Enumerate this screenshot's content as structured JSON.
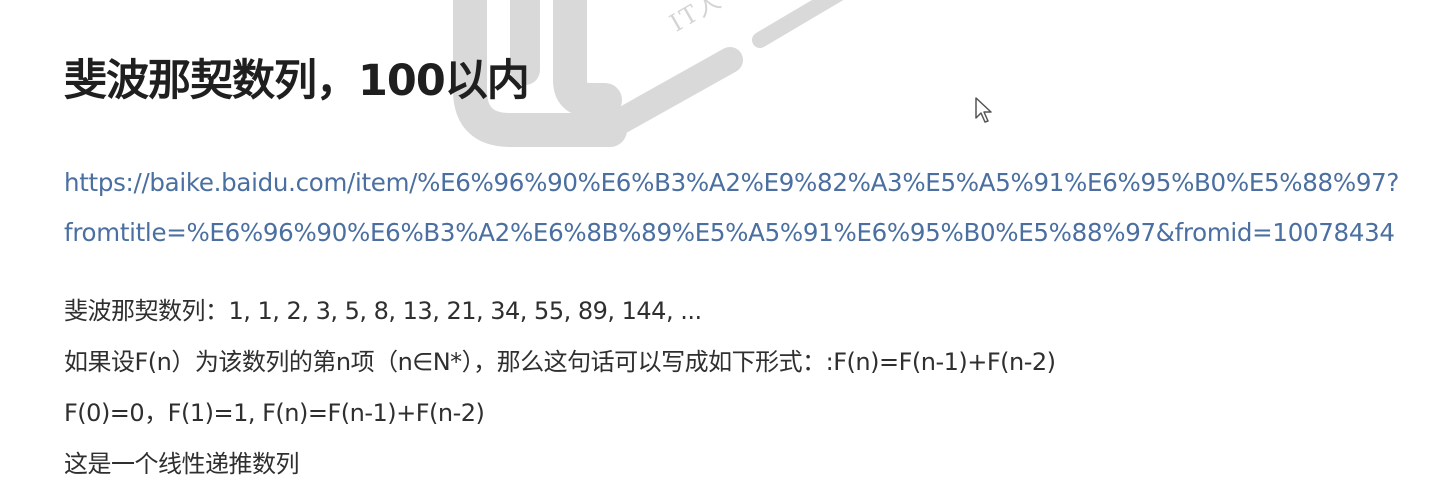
{
  "title": "斐波那契数列，100以内",
  "link": {
    "line1": "https://baike.baidu.com/item/%E6%96%90%E6%B3%A2%E9%82%A3%E5%A5%91%E6%95%B0%E5%88%97?",
    "line2": "fromtitle=%E6%96%90%E6%B3%A2%E6%8B%89%E5%A5%91%E6%95%B0%E5%88%97&fromid=10078434"
  },
  "paragraphs": [
    "斐波那契数列：1, 1, 2, 3, 5, 8, 13, 21, 34, 55, 89, 144, ...",
    "如果设F(n）为该数列的第n项（n∈N*），那么这句话可以写成如下形式：:F(n)=F(n-1)+F(n-2)",
    "F(0)=0，F(1)=1, F(n)=F(n-1)+F(n-2)",
    "这是一个线性递推数列"
  ],
  "watermark": {
    "icon": "watermark-logo-icon",
    "text": "IT人"
  },
  "cursor": {
    "icon": "mouse-pointer-icon"
  },
  "colors": {
    "title": "#1f1f1f",
    "link": "#4a6fa0",
    "body": "#2f2f2f",
    "watermark": "#d4d4d4"
  }
}
